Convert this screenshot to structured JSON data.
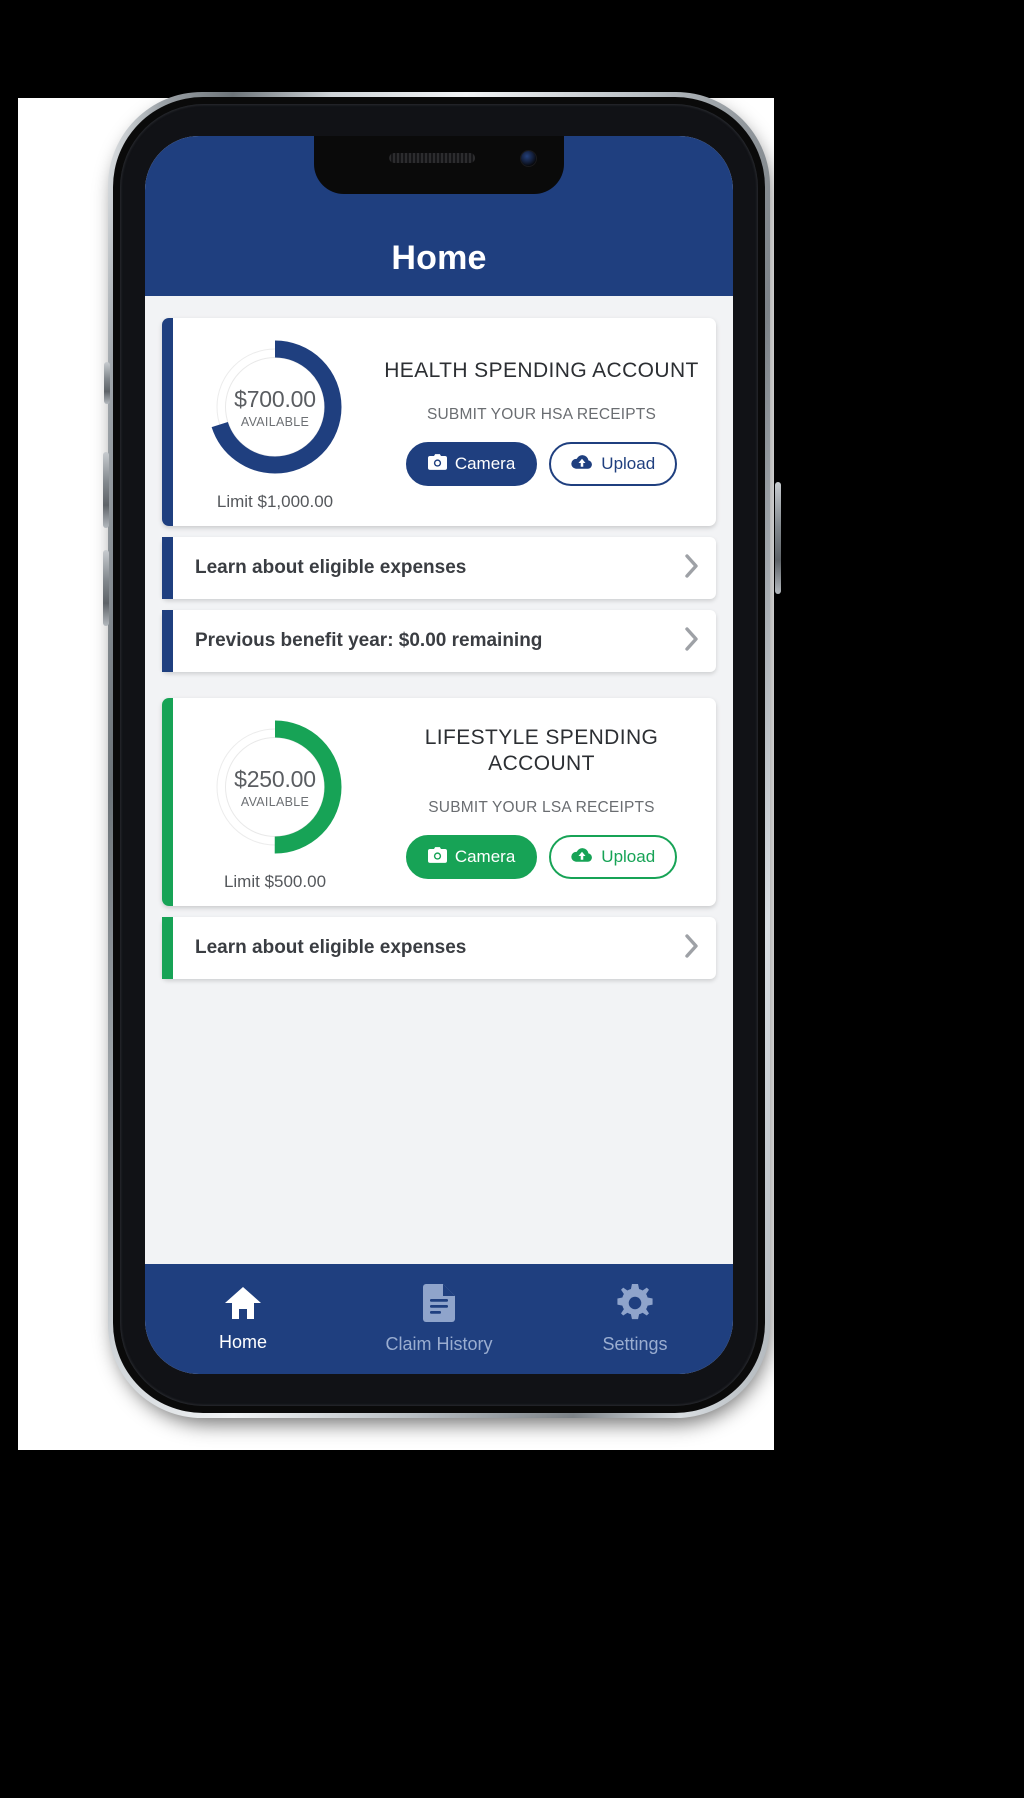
{
  "header": {
    "title": "Home"
  },
  "accounts": [
    {
      "id": "hsa",
      "title": "HEALTH SPENDING ACCOUNT",
      "available_amount": "$700.00",
      "available_label": "AVAILABLE",
      "limit_text": "Limit $1,000.00",
      "submit_prompt": "SUBMIT YOUR HSA RECEIPTS",
      "camera_label": "Camera",
      "upload_label": "Upload",
      "accent_color": "#1f3f7f",
      "track_color": "#ffffff",
      "available_value": 700,
      "limit_value": 1000,
      "arc_percent": 70,
      "links": [
        {
          "label": "Learn about eligible expenses",
          "icon": "chevron-right-icon"
        },
        {
          "label": "Previous benefit year: $0.00 remaining",
          "icon": "chevron-right-icon"
        }
      ]
    },
    {
      "id": "lsa",
      "title": "LIFESTYLE SPENDING ACCOUNT",
      "available_amount": "$250.00",
      "available_label": "AVAILABLE",
      "limit_text": "Limit $500.00",
      "submit_prompt": "SUBMIT YOUR LSA RECEIPTS",
      "camera_label": "Camera",
      "upload_label": "Upload",
      "accent_color": "#17a356",
      "track_color": "#ffffff",
      "available_value": 250,
      "limit_value": 500,
      "arc_percent": 50,
      "links": [
        {
          "label": "Learn about eligible expenses",
          "icon": "chevron-right-icon"
        }
      ]
    }
  ],
  "tabbar": {
    "active_color": "#ffffff",
    "inactive_color": "#8fa4cb",
    "background": "#1f3f7f",
    "tabs": [
      {
        "label": "Home",
        "icon": "home-icon",
        "active": true
      },
      {
        "label": "Claim History",
        "icon": "document-icon",
        "active": false
      },
      {
        "label": "Settings",
        "icon": "gear-icon",
        "active": false
      }
    ]
  },
  "icons": {
    "camera": "camera-icon",
    "upload": "cloud-upload-icon",
    "chevron": "chevron-right-icon"
  }
}
